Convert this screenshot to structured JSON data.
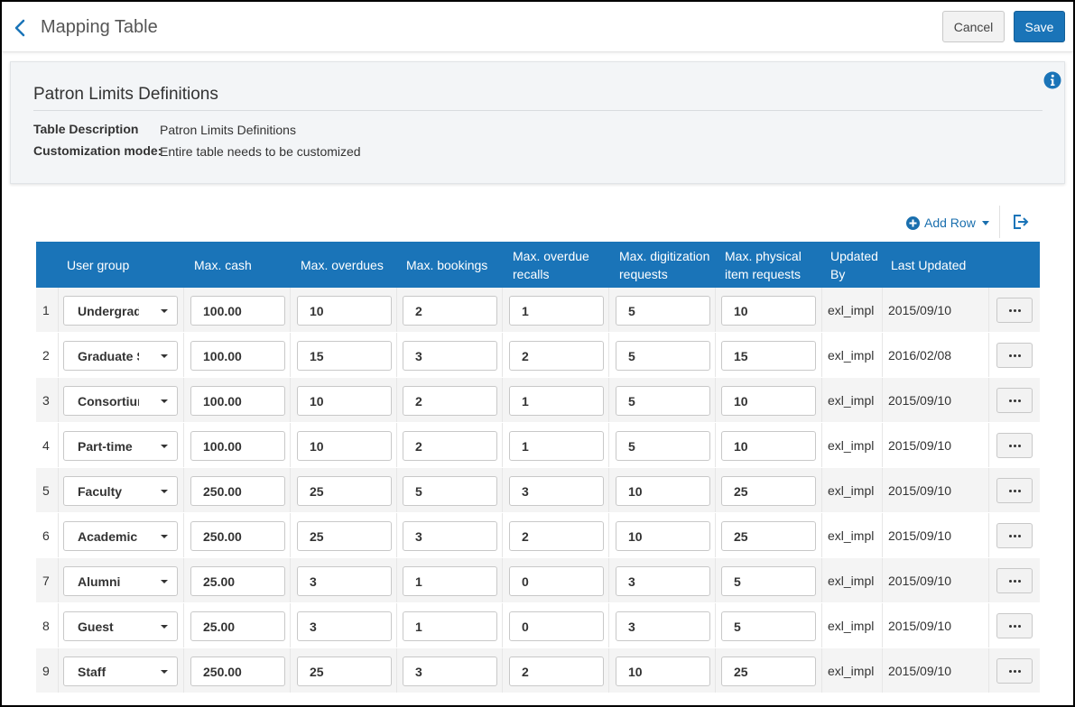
{
  "header": {
    "title": "Mapping Table",
    "cancel_label": "Cancel",
    "save_label": "Save"
  },
  "panel": {
    "title": "Patron Limits Definitions",
    "table_description_label": "Table Description",
    "table_description_value": "Patron Limits Definitions",
    "customization_mode_label": "Customization mode:",
    "customization_mode_value": "Entire table needs to be customized"
  },
  "toolbar": {
    "add_row_label": "Add Row"
  },
  "table": {
    "columns": {
      "user_group": "User group",
      "max_cash": "Max. cash",
      "max_overdues": "Max. overdues",
      "max_bookings": "Max. bookings",
      "max_overdue_recalls": "Max. overdue recalls",
      "max_digitization_requests": "Max. digitization requests",
      "max_physical_item_requests": "Max. physical item requests",
      "updated_by": "Updated By",
      "last_updated": "Last Updated"
    },
    "rows": [
      {
        "num": "1",
        "user_group": "Undergraduate",
        "max_cash": "100.00",
        "max_overdues": "10",
        "max_bookings": "2",
        "max_overdue_recalls": "1",
        "max_digitization_requests": "5",
        "max_physical_item_requests": "10",
        "updated_by": "exl_impl",
        "last_updated": "2015/09/10"
      },
      {
        "num": "2",
        "user_group": "Graduate Student",
        "max_cash": "100.00",
        "max_overdues": "15",
        "max_bookings": "3",
        "max_overdue_recalls": "2",
        "max_digitization_requests": "5",
        "max_physical_item_requests": "15",
        "updated_by": "exl_impl",
        "last_updated": "2016/02/08"
      },
      {
        "num": "3",
        "user_group": "Consortium",
        "max_cash": "100.00",
        "max_overdues": "10",
        "max_bookings": "2",
        "max_overdue_recalls": "1",
        "max_digitization_requests": "5",
        "max_physical_item_requests": "10",
        "updated_by": "exl_impl",
        "last_updated": "2015/09/10"
      },
      {
        "num": "4",
        "user_group": "Part-time",
        "max_cash": "100.00",
        "max_overdues": "10",
        "max_bookings": "2",
        "max_overdue_recalls": "1",
        "max_digitization_requests": "5",
        "max_physical_item_requests": "10",
        "updated_by": "exl_impl",
        "last_updated": "2015/09/10"
      },
      {
        "num": "5",
        "user_group": "Faculty",
        "max_cash": "250.00",
        "max_overdues": "25",
        "max_bookings": "5",
        "max_overdue_recalls": "3",
        "max_digitization_requests": "10",
        "max_physical_item_requests": "25",
        "updated_by": "exl_impl",
        "last_updated": "2015/09/10"
      },
      {
        "num": "6",
        "user_group": "Academic",
        "max_cash": "250.00",
        "max_overdues": "25",
        "max_bookings": "3",
        "max_overdue_recalls": "2",
        "max_digitization_requests": "10",
        "max_physical_item_requests": "25",
        "updated_by": "exl_impl",
        "last_updated": "2015/09/10"
      },
      {
        "num": "7",
        "user_group": "Alumni",
        "max_cash": "25.00",
        "max_overdues": "3",
        "max_bookings": "1",
        "max_overdue_recalls": "0",
        "max_digitization_requests": "3",
        "max_physical_item_requests": "5",
        "updated_by": "exl_impl",
        "last_updated": "2015/09/10"
      },
      {
        "num": "8",
        "user_group": "Guest",
        "max_cash": "25.00",
        "max_overdues": "3",
        "max_bookings": "1",
        "max_overdue_recalls": "0",
        "max_digitization_requests": "3",
        "max_physical_item_requests": "5",
        "updated_by": "exl_impl",
        "last_updated": "2015/09/10"
      },
      {
        "num": "9",
        "user_group": "Staff",
        "max_cash": "250.00",
        "max_overdues": "25",
        "max_bookings": "3",
        "max_overdue_recalls": "2",
        "max_digitization_requests": "10",
        "max_physical_item_requests": "25",
        "updated_by": "exl_impl",
        "last_updated": "2015/09/10"
      }
    ]
  },
  "colors": {
    "accent": "#1a74b8",
    "header_row": "#1a74b8",
    "row_alt": "#f4f4f4"
  },
  "icons": [
    "back-chevron-icon",
    "info-icon",
    "plus-circle-icon",
    "export-icon",
    "ellipsis-icon"
  ]
}
